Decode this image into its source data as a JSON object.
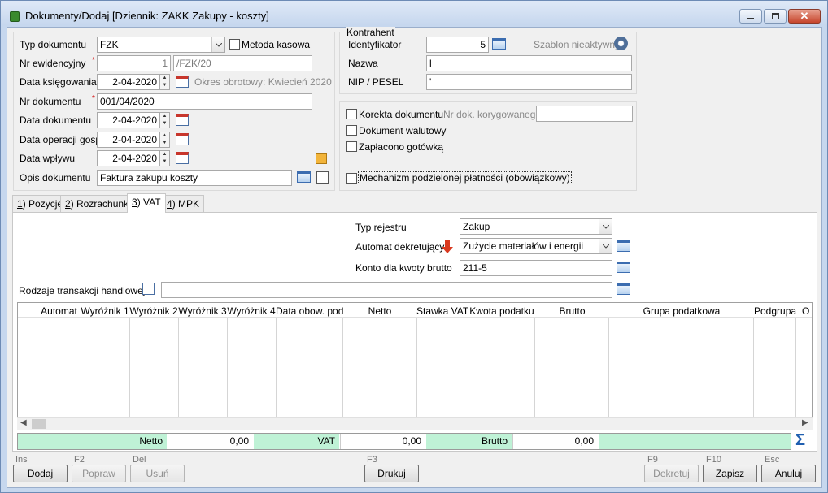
{
  "window": {
    "title": "Dokumenty/Dodaj [Dziennik: ZAKK  Zakupy - koszty]"
  },
  "left_panel": {
    "typ_dokumentu": {
      "label": "Typ dokumentu",
      "value": "FZK"
    },
    "metoda_kasowa": {
      "label": "Metoda kasowa",
      "checked": false
    },
    "nr_ewidencyjny": {
      "label": "Nr ewidencyjny",
      "required_mark": "*",
      "number": "1",
      "suffix": "/FZK/20"
    },
    "data_ksiegowania": {
      "label": "Data księgowania",
      "value": "2-04-2020",
      "okres": "Okres obrotowy: Kwiecień 2020"
    },
    "nr_dokumentu": {
      "label": "Nr dokumentu",
      "required_mark": "*",
      "value": "001/04/2020"
    },
    "data_dokumentu": {
      "label": "Data dokumentu",
      "value": "2-04-2020"
    },
    "data_operacji": {
      "label": "Data operacji gosp.",
      "value": "2-04-2020"
    },
    "data_wplywu": {
      "label": "Data wpływu",
      "value": "2-04-2020"
    },
    "opis_dokumentu": {
      "label": "Opis dokumentu",
      "value": "Faktura zakupu koszty"
    }
  },
  "kontrahent": {
    "group_label": "Kontrahent",
    "identyfikator": {
      "label": "Identyfikator",
      "value": "5"
    },
    "szablon": "Szablon nieaktywny",
    "nazwa": {
      "label": "Nazwa",
      "value": "l"
    },
    "nip": {
      "label": "NIP / PESEL",
      "value": "'"
    }
  },
  "options": {
    "korekta": {
      "label": "Korekta dokumentu",
      "checked": false
    },
    "nr_dok_korygowanego": {
      "label": "Nr dok. korygowanego",
      "value": ""
    },
    "walutowy": {
      "label": "Dokument walutowy",
      "checked": false
    },
    "gotowka": {
      "label": "Zapłacono gotówką",
      "checked": false
    },
    "mechanizm": {
      "label": "Mechanizm podzielonej płatności (obowiązkowy)",
      "checked": false
    }
  },
  "tabs": [
    {
      "key": "1",
      "label": ") Pozycje"
    },
    {
      "key": "2",
      "label": ") Rozrachunki"
    },
    {
      "key": "3",
      "label": ") VAT"
    },
    {
      "key": "4",
      "label": ") MPK"
    }
  ],
  "vat": {
    "typ_rejestru": {
      "label": "Typ rejestru",
      "value": "Zakup"
    },
    "automat": {
      "label": "Automat dekretujący",
      "value": "Zużycie materiałów i energii"
    },
    "konto": {
      "label": "Konto dla kwoty brutto",
      "value": "211-5"
    },
    "rodzaje": {
      "label": "Rodzaje transakcji handlowej",
      "value": ""
    }
  },
  "grid": {
    "columns": [
      "Automat",
      "Wyróżnik 1",
      "Wyróżnik 2",
      "Wyróżnik 3",
      "Wyróżnik 4",
      "Data obow. pod.",
      "Netto",
      "Stawka VAT",
      "Kwota podatku",
      "Brutto",
      "Grupa podatkowa",
      "Podgrupa",
      "O"
    ]
  },
  "summary": {
    "netto_label": "Netto",
    "netto_value": "0,00",
    "vat_label": "VAT",
    "vat_value": "0,00",
    "brutto_label": "Brutto",
    "brutto_value": "0,00"
  },
  "buttons": {
    "dodaj": {
      "key": "Ins",
      "label": "Dodaj"
    },
    "popraw": {
      "key": "F2",
      "label": "Popraw"
    },
    "usun": {
      "key": "Del",
      "label": "Usuń"
    },
    "drukuj": {
      "key": "F3",
      "label": "Drukuj"
    },
    "dekretuj": {
      "key": "F9",
      "label": "Dekretuj"
    },
    "zapisz": {
      "key": "F10",
      "label": "Zapisz"
    },
    "anuluj": {
      "key": "Esc",
      "label": "Anuluj"
    }
  },
  "colors": {
    "summary_green": "#bff2d6",
    "arrow_red": "#d9381e",
    "sigma_blue": "#1f5fb0"
  }
}
